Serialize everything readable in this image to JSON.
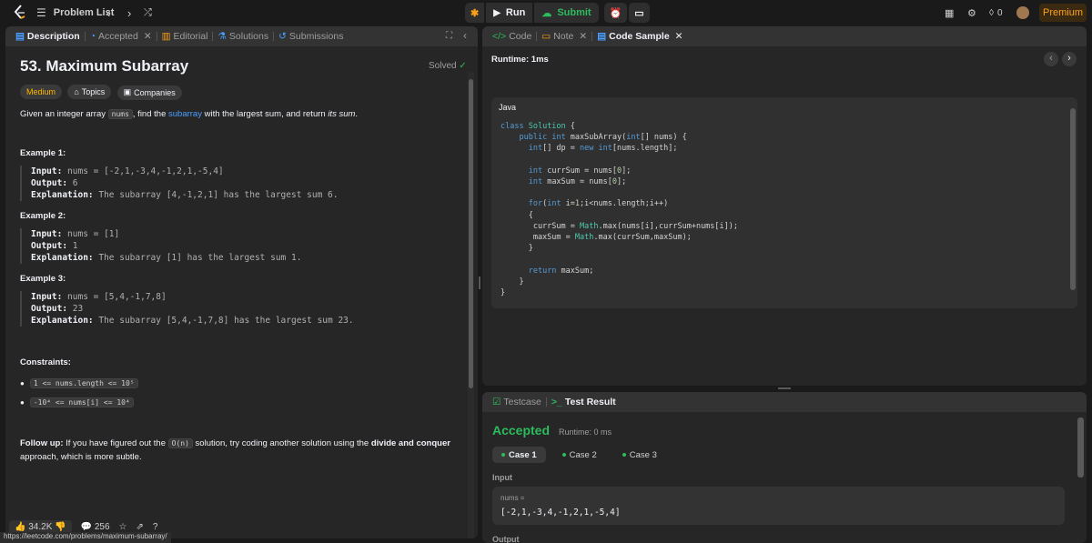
{
  "nav": {
    "problem_list": "Problem List",
    "run": "Run",
    "submit": "Submit",
    "streak": "0",
    "premium": "Premium"
  },
  "left_tabs": [
    "Description",
    "Accepted",
    "Editorial",
    "Solutions",
    "Submissions"
  ],
  "problem": {
    "title": "53. Maximum Subarray",
    "status": "Solved",
    "difficulty": "Medium",
    "topics": "Topics",
    "companies": "Companies",
    "statement_1": "Given an integer array ",
    "statement_code": "nums",
    "statement_2": ", find the ",
    "statement_link": "subarray",
    "statement_3": " with the largest sum, and return ",
    "statement_4": "its sum",
    "statement_5": ".",
    "examples": [
      {
        "title": "Example 1:",
        "input_label": "Input:",
        "input": " nums = [-2,1,-3,4,-1,2,1,-5,4]",
        "output_label": "Output:",
        "output": " 6",
        "exp_label": "Explanation:",
        "explanation": " The subarray [4,-1,2,1] has the largest sum 6."
      },
      {
        "title": "Example 2:",
        "input_label": "Input:",
        "input": " nums = [1]",
        "output_label": "Output:",
        "output": " 1",
        "exp_label": "Explanation:",
        "explanation": " The subarray [1] has the largest sum 1."
      },
      {
        "title": "Example 3:",
        "input_label": "Input:",
        "input": " nums = [5,4,-1,7,8]",
        "output_label": "Output:",
        "output": " 23",
        "exp_label": "Explanation:",
        "explanation": " The subarray [5,4,-1,7,8] has the largest sum 23."
      }
    ],
    "constraints_title": "Constraints:",
    "constraint_1": "1 <= nums.length <= 10⁵",
    "constraint_2": "-10⁴ <= nums[i] <= 10⁴",
    "followup_label": "Follow up:",
    "followup_1": " If you have figured out the ",
    "followup_code": "O(n)",
    "followup_2": " solution, try coding another solution using the ",
    "followup_bold": "divide and conquer",
    "followup_3": " approach, which is more subtle.",
    "likes": "34.2K",
    "comments": "256"
  },
  "status_url": "https://leetcode.com/problems/maximum-subarray/",
  "right_tabs": [
    "Code",
    "Note",
    "Code Sample"
  ],
  "runtime_label": "Runtime: 1ms",
  "code_lang": "Java",
  "result_tabs": [
    "Testcase",
    "Test Result"
  ],
  "result": {
    "verdict": "Accepted",
    "runtime": "Runtime: 0 ms",
    "cases": [
      "Case 1",
      "Case 2",
      "Case 3"
    ],
    "input_label": "Input",
    "var_label": "nums =",
    "var_value": "[-2,1,-3,4,-1,2,1,-5,4]",
    "output_label": "Output"
  },
  "colors": {
    "accent": "#ffa116",
    "accepted": "#2cbb5d",
    "medium": "#ffb800",
    "link": "#4a9eff"
  }
}
